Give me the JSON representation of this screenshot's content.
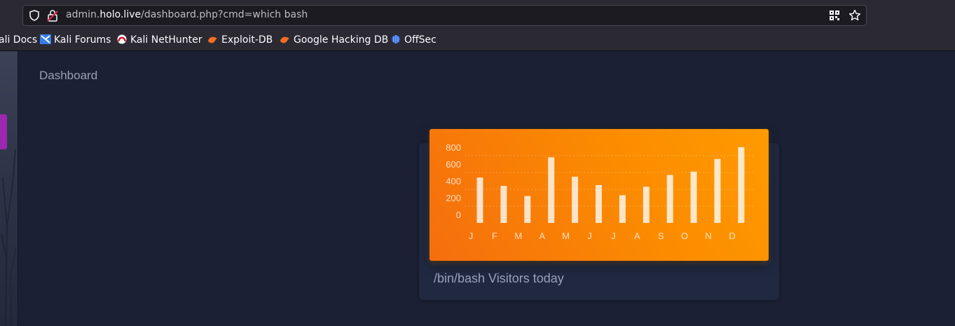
{
  "browser": {
    "url_prefix": "admin.",
    "url_host": "holo.live",
    "url_path": "/dashboard.php?cmd=which bash",
    "bookmarks": [
      {
        "label": "ali Docs",
        "icon": "kali-docs-icon"
      },
      {
        "label": "Kali Forums",
        "icon": "kali-forums-icon"
      },
      {
        "label": "Kali NetHunter",
        "icon": "kali-nethunter-icon"
      },
      {
        "label": "Exploit-DB",
        "icon": "exploit-db-icon"
      },
      {
        "label": "Google Hacking DB",
        "icon": "google-hacking-db-icon"
      },
      {
        "label": "OffSec",
        "icon": "offsec-icon"
      }
    ]
  },
  "page": {
    "title": "Dashboard",
    "card_title": "/bin/bash Visitors today",
    "accent": "#fb8c00"
  },
  "chart_data": {
    "type": "bar",
    "categories": [
      "J",
      "F",
      "M",
      "A",
      "M",
      "J",
      "J",
      "A",
      "S",
      "O",
      "N",
      "D"
    ],
    "values": [
      540,
      440,
      320,
      780,
      550,
      450,
      330,
      430,
      570,
      610,
      760,
      900
    ],
    "yticks": [
      "800",
      "600",
      "400",
      "200",
      "0"
    ],
    "grid": true,
    "title": "",
    "xlabel": "",
    "ylabel": ""
  }
}
